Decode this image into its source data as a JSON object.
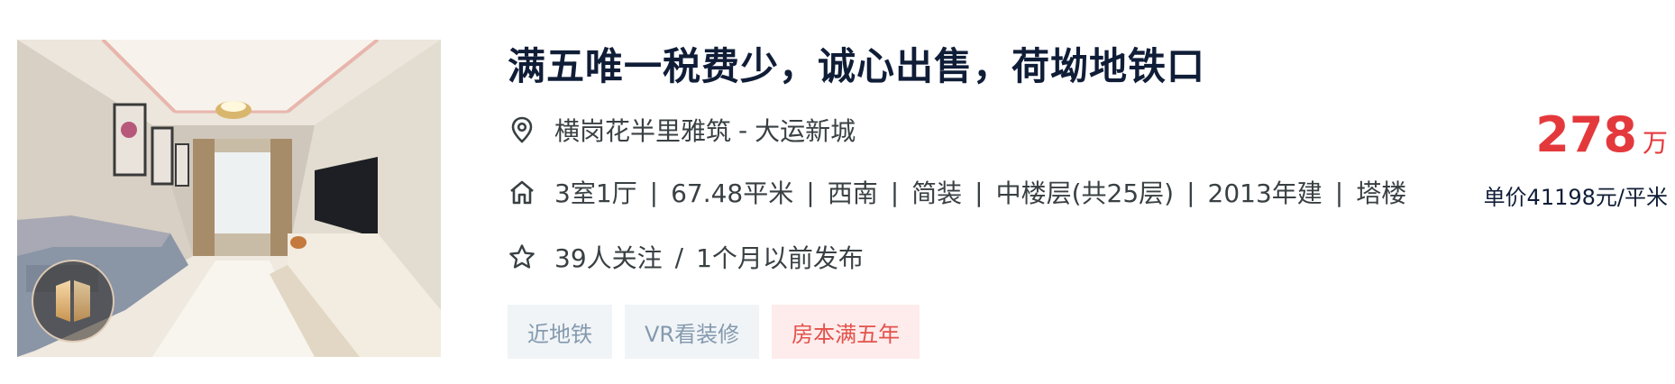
{
  "listing": {
    "title": "满五唯一税费少，诚心出售，荷坳地铁口",
    "location": {
      "community": "横岗花半里雅筑",
      "separator": "-",
      "area": "大运新城"
    },
    "house_info": [
      "3室1厅",
      "67.48平米",
      "西南",
      "简装",
      "中楼层(共25层)",
      "2013年建",
      "塔楼"
    ],
    "house_info_separator": "|",
    "follow": {
      "followers": "39人关注",
      "separator": "/",
      "published": "1个月以前发布"
    },
    "tags": [
      {
        "label": "近地铁",
        "style": "blue"
      },
      {
        "label": "VR看装修",
        "style": "blue"
      },
      {
        "label": "房本满五年",
        "style": "red"
      }
    ],
    "price": {
      "total": "278",
      "total_unit": "万",
      "unit_price": "单价41198元/平米"
    },
    "icons": {
      "location": "location-pin-icon",
      "house": "house-icon",
      "follow": "star-icon",
      "vr": "vr-badge-icon"
    },
    "colors": {
      "price": "#e4393c",
      "tag_blue_bg": "#f1f4f7",
      "tag_blue_text": "#849aae",
      "tag_red_bg": "#fdeceb",
      "tag_red_text": "#e4524c"
    }
  }
}
